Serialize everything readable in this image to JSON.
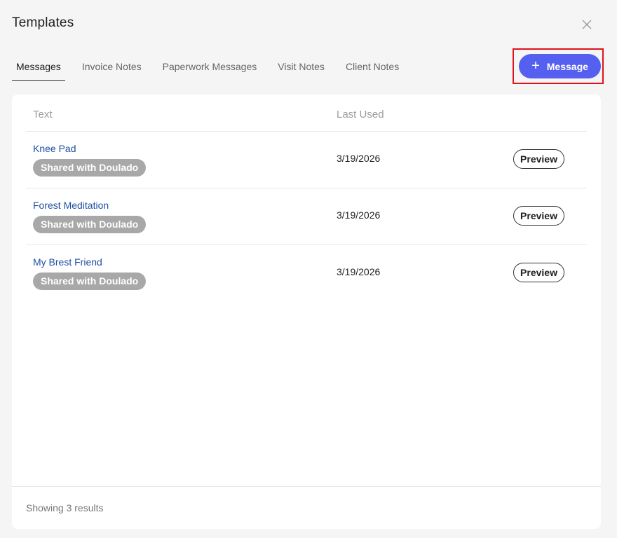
{
  "dialog": {
    "title": "Templates",
    "close_icon": "close-icon"
  },
  "tabs": [
    {
      "label": "Messages",
      "active": true
    },
    {
      "label": "Invoice Notes",
      "active": false
    },
    {
      "label": "Paperwork Messages",
      "active": false
    },
    {
      "label": "Visit Notes",
      "active": false
    },
    {
      "label": "Client Notes",
      "active": false
    }
  ],
  "add_button": {
    "icon": "plus-icon",
    "label": "Message",
    "color": "#5660f0",
    "highlight_color": "#e0121b"
  },
  "table": {
    "columns": [
      "Text",
      "Last Used"
    ],
    "rows": [
      {
        "name": "Knee Pad",
        "badge": "Shared with Doulado",
        "last_used": "3/19/2026",
        "action": "Preview"
      },
      {
        "name": "Forest Meditation",
        "badge": "Shared with Doulado",
        "last_used": "3/19/2026",
        "action": "Preview"
      },
      {
        "name": "My Brest Friend",
        "badge": "Shared with Doulado",
        "last_used": "3/19/2026",
        "action": "Preview"
      }
    ]
  },
  "footer": {
    "results_text": "Showing 3 results"
  }
}
